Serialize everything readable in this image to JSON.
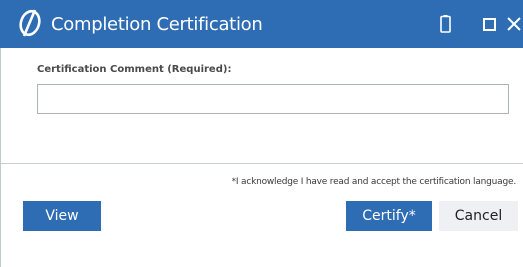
{
  "window": {
    "title": "Completion Certification",
    "controls": [
      "phone-icon",
      "maximize-icon",
      "close-icon"
    ]
  },
  "form": {
    "comment_label": "Certification Comment (Required):",
    "comment_value": "",
    "comment_placeholder": ""
  },
  "footer": {
    "acknowledgement": "*I acknowledge I have read and accept the certification language.",
    "view_label": "View",
    "certify_label": "Certify*",
    "cancel_label": "Cancel"
  },
  "colors": {
    "titlebar": "#2e6cb4",
    "primary_button": "#2e6cb4",
    "secondary_button": "#eef0f3"
  }
}
